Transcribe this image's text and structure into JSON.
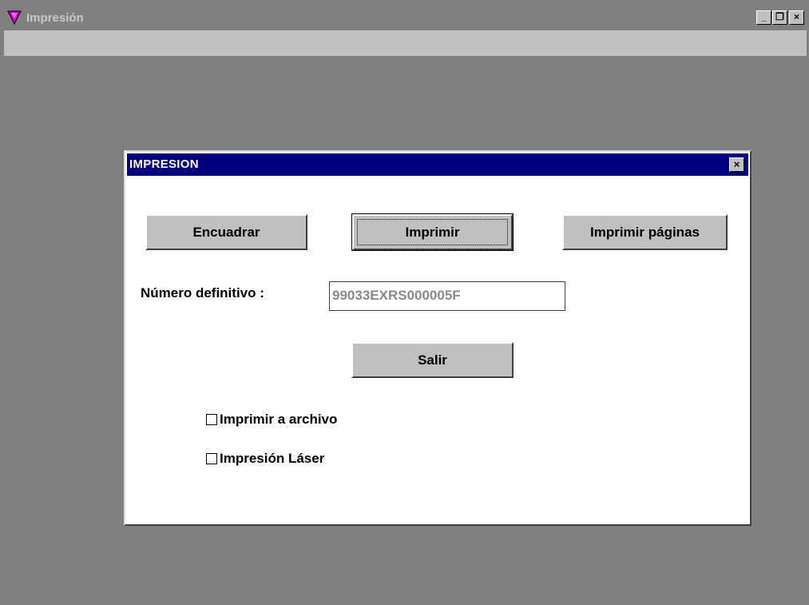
{
  "app": {
    "title": "Impresión",
    "controls": {
      "minimize": "_",
      "restore": "❐",
      "close": "×"
    }
  },
  "dialog": {
    "title": "IMPRESION",
    "close_label": "×",
    "buttons": {
      "encuadrar": "Encuadrar",
      "imprimir": "Imprimir",
      "imprimir_paginas": "Imprimir páginas",
      "salir": "Salir"
    },
    "numero_definitivo": {
      "label": "Número definitivo :",
      "value": "99033EXRS000005F"
    },
    "checkboxes": [
      {
        "label": "Imprimir a archivo",
        "checked": false
      },
      {
        "label": "Impresión Láser",
        "checked": false
      }
    ]
  },
  "colors": {
    "dialog_title_bg": "#000080",
    "face": "#c0c0c0",
    "desktop": "#808080"
  }
}
